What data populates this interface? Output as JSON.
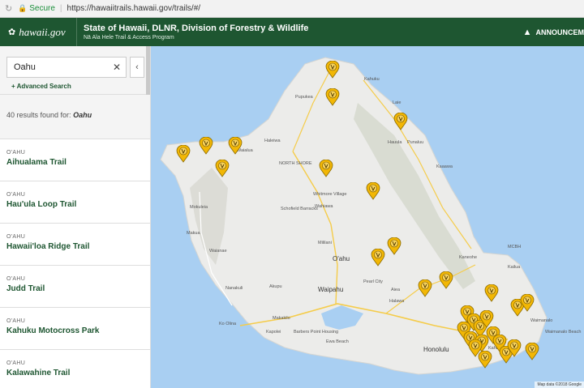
{
  "browser": {
    "secure_label": "Secure",
    "url": "https://hawaiitrails.hawaii.gov/trails/#/"
  },
  "header": {
    "logo_text": "hawaii.gov",
    "title": "State of Hawaii, DLNR, Division of Forestry & Wildlife",
    "subtitle": "Nā Ala Hele Trail & Access Program",
    "announce": "ANNOUNCEM"
  },
  "sidebar": {
    "search_value": "Oahu",
    "advanced_label": "+ Advanced Search",
    "results_text": "40 results found for:",
    "results_query": "Oahu",
    "items": [
      {
        "region": "O'AHU",
        "name": "Aihualama Trail"
      },
      {
        "region": "O'AHU",
        "name": "Hau'ula Loop Trail"
      },
      {
        "region": "O'AHU",
        "name": "Hawaii'loa Ridge Trail"
      },
      {
        "region": "O'AHU",
        "name": "Judd Trail"
      },
      {
        "region": "O'AHU",
        "name": "Kahuku Motocross Park"
      },
      {
        "region": "O'AHU",
        "name": "Kalawahine Trail"
      }
    ]
  },
  "map": {
    "place_labels": [
      "Kahuku",
      "Pupukea",
      "Laie",
      "Hauula",
      "Punaluu",
      "Haleiwa",
      "Waialua",
      "NORTH SHORE",
      "Kaaawa",
      "Whitmore Village",
      "Wahiawa",
      "Schofield Barracks",
      "Mililani",
      "Mokuleia",
      "Makua",
      "Waianae",
      "Nanakuli",
      "Kapolei",
      "Makakilo",
      "Akupu",
      "Waipahu",
      "Pearl City",
      "Aiea",
      "Halawa",
      "Kaneohe",
      "Kailua",
      "MCBH",
      "Waimanalo",
      "Waimanalo Beach",
      "Ewa Beach",
      "Barbers Point Housing",
      "Honolulu",
      "Kahala",
      "Ko Olina"
    ],
    "main_label": "O'ahu",
    "city_label": "Honolulu",
    "data_text": "Map data ©2018 Google"
  },
  "colors": {
    "header_bg": "#1e5631",
    "link_green": "#1e5631",
    "water": "#a9cff2",
    "land": "#ececea",
    "pin": "#f2b705"
  }
}
